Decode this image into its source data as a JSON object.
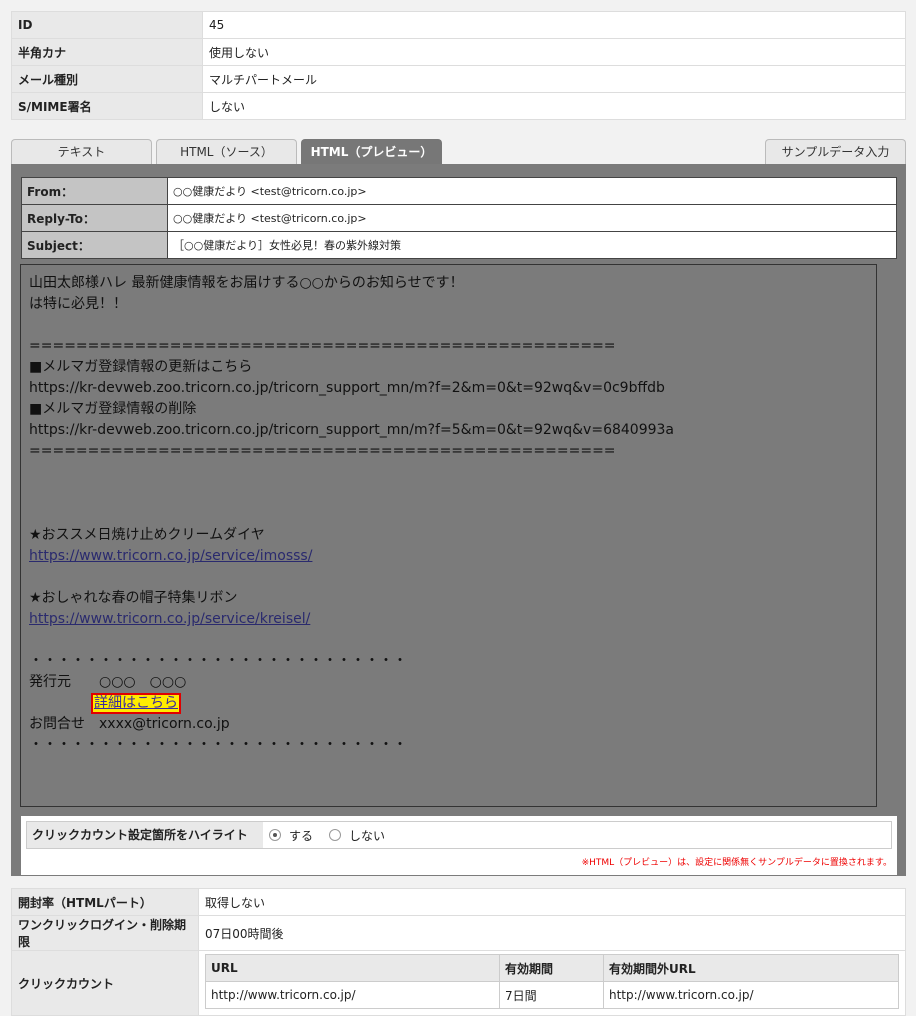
{
  "info": {
    "rows": [
      {
        "label": "ID",
        "value": "45"
      },
      {
        "label": "半角カナ",
        "value": "使用しない"
      },
      {
        "label": "メール種別",
        "value": "マルチパートメール"
      },
      {
        "label": "S/MIME署名",
        "value": "しない"
      }
    ]
  },
  "tabs": {
    "text": "テキスト",
    "html_source": "HTML（ソース）",
    "html_preview": "HTML（プレビュー）",
    "sample_data": "サンプルデータ入力"
  },
  "header": {
    "from_label": "From：",
    "from_value": "○○健康だより <test@tricorn.co.jp>",
    "replyto_label": "Reply-To：",
    "replyto_value": "○○健康だより <test@tricorn.co.jp>",
    "subject_label": "Subject：",
    "subject_value": "［○○健康だより］女性必見！春の紫外線対策"
  },
  "mail": {
    "line1": "山田太郎様ハレ 最新健康情報をお届けする○○からのお知らせです！",
    "line2": "は特に必見！！",
    "separator": "==================================================",
    "update_label": "■メルマガ登録情報の更新はこちら",
    "update_url": "https://kr-devweb.zoo.tricorn.co.jp/tricorn_support_mn/m?f=2&m=0&t=92wq&v=0c9bffdb",
    "delete_label": "■メルマガ登録情報の削除",
    "delete_url": "https://kr-devweb.zoo.tricorn.co.jp/tricorn_support_mn/m?f=5&m=0&t=92wq&v=6840993a",
    "item1_title": "★おススメ日焼け止めクリームダイヤ",
    "item1_url": "https://www.tricorn.co.jp/service/imosss/",
    "item2_title": "★おしゃれな春の帽子特集リボン",
    "item2_url": "https://www.tricorn.co.jp/service/kreisel/",
    "dots": "・・・・・・・・・・・・・・・・・・・・・・・・・・・",
    "publisher_line": "発行元　　○○○　○○○",
    "details_link": "詳細はこちら",
    "contact_line": "お問合せ　xxxx@tricorn.co.jp"
  },
  "highlight": {
    "label": "クリックカウント設定箇所をハイライト",
    "option_on": "する",
    "option_off": "しない",
    "selected": "する",
    "note": "※HTML（プレビュー）は、設定に関係無くサンプルデータに置換されます。"
  },
  "meta": {
    "open_rate_label": "開封率（HTMLパート）",
    "open_rate_value": "取得しない",
    "oneclick_label": "ワンクリックログイン・削除期限",
    "oneclick_value": "07日00時間後",
    "click_count_label": "クリックカウント",
    "click_table": {
      "headers": [
        "URL",
        "有効期間",
        "有効期間外URL"
      ],
      "rows": [
        [
          "http://www.tricorn.co.jp/",
          "7日間",
          "http://www.tricorn.co.jp/"
        ]
      ]
    }
  },
  "colors": {
    "panel_bg": "#7b7b7b",
    "highlight_fill": "#ffec00",
    "highlight_border": "#e00000",
    "note_text": "#e00000"
  }
}
